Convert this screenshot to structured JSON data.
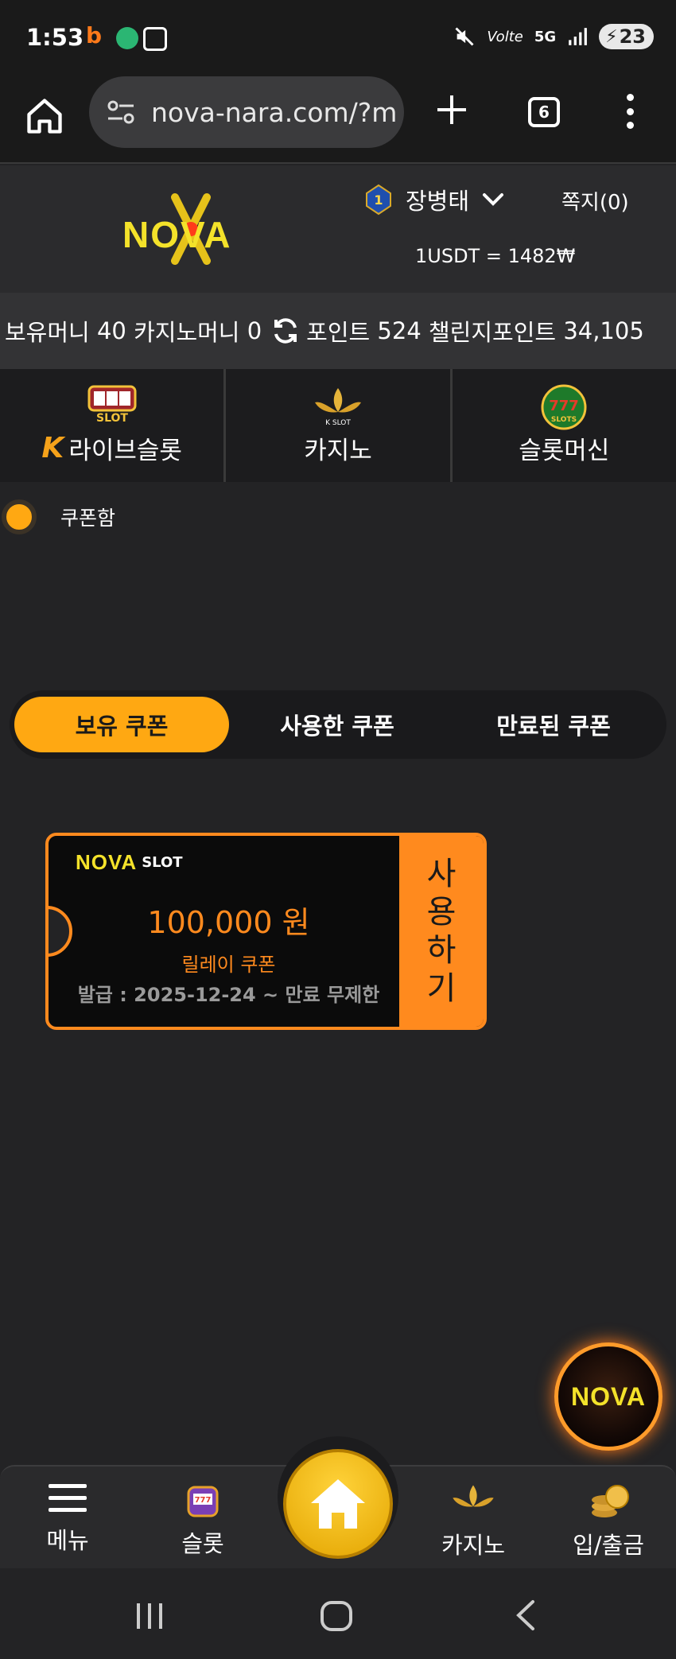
{
  "status_bar": {
    "time": "1:53",
    "battery": "23",
    "network": "5G"
  },
  "browser": {
    "url": "nova-nara.com/?m",
    "tab_count": "6"
  },
  "header": {
    "logo": "NOVA",
    "username": "장병태",
    "level": "1",
    "messages": "쪽지(0)",
    "rate": "1USDT = 1482₩"
  },
  "balance": {
    "holding_label": "보유머니",
    "holding_value": "40",
    "casino_label": "카지노머니",
    "casino_value": "0",
    "points_label": "포인트",
    "points_value": "524",
    "challenge_label": "챌린지포인트",
    "challenge_value": "34,105"
  },
  "categories": [
    {
      "label": "라이브슬롯",
      "icon": "live-slot-icon"
    },
    {
      "label": "카지노",
      "icon": "k-slot-lotus-icon"
    },
    {
      "label": "슬롯머신",
      "icon": "777-slots-icon"
    }
  ],
  "coupon_box": {
    "title": "쿠폰함"
  },
  "coupon_tabs": [
    {
      "label": "보유 쿠폰",
      "active": true
    },
    {
      "label": "사용한 쿠폰",
      "active": false
    },
    {
      "label": "만료된 쿠폰",
      "active": false
    }
  ],
  "coupon": {
    "logo_nova": "NOVA",
    "logo_slot": "SLOT",
    "amount": "100,000 원",
    "type": "릴레이 쿠폰",
    "issued": "발급 : 2025-12-24 ~ 만료 무제한",
    "use_label": "사용하기"
  },
  "floating": {
    "logo": "NOVA"
  },
  "bottom_nav": {
    "menu": "메뉴",
    "slot": "슬롯",
    "casino": "카지노",
    "deposit": "입/출금"
  },
  "colors": {
    "accent": "#ffa812",
    "coupon_orange": "#ff8a1e",
    "background": "#232325"
  }
}
